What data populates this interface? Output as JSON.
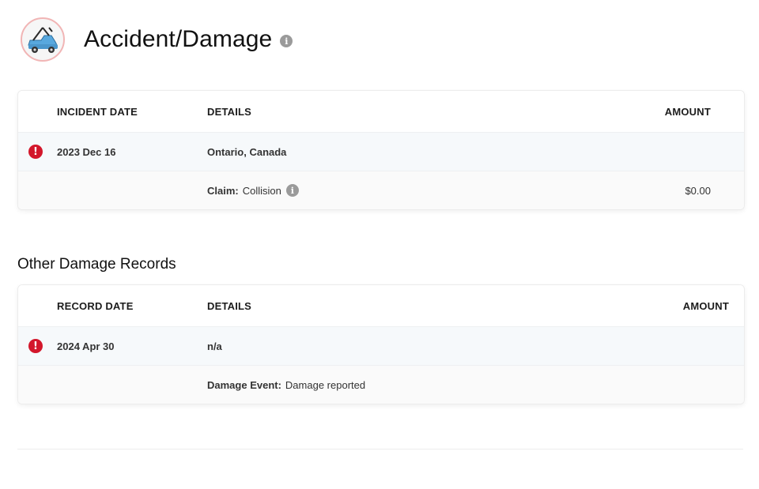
{
  "header": {
    "title": "Accident/Damage",
    "info_icon": "i",
    "logo_icon": "tow-truck-icon"
  },
  "accidents_table": {
    "columns": [
      "INCIDENT DATE",
      "DETAILS",
      "AMOUNT"
    ],
    "rows": [
      {
        "status_icon": "!",
        "date": "2023 Dec 16",
        "details": "Ontario, Canada",
        "claim_label": "Claim:",
        "claim_value": "Collision",
        "claim_info_icon": "i",
        "amount": "$0.00"
      }
    ]
  },
  "other_damage": {
    "title": "Other Damage Records",
    "columns": [
      "RECORD DATE",
      "DETAILS",
      "AMOUNT"
    ],
    "rows": [
      {
        "status_icon": "!",
        "date": "2024 Apr 30",
        "details": "n/a",
        "event_label": "Damage Event:",
        "event_value": "Damage reported"
      }
    ]
  },
  "colors": {
    "alert": "#d3172b",
    "info": "#9a9a9a",
    "row_highlight": "#f6f9fb"
  }
}
